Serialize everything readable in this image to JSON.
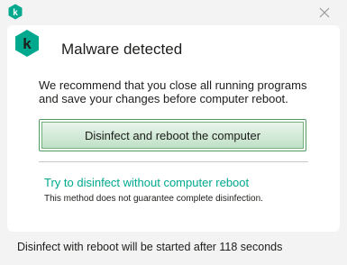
{
  "window": {
    "close_label": "Close"
  },
  "dialog": {
    "heading": "Malware detected",
    "message": "We recommend that you close all running programs and save your changes before computer reboot.",
    "primary_button_label": "Disinfect and reboot the computer",
    "alt_link_label": "Try to disinfect without computer reboot",
    "alt_note": "This method does not guarantee complete disinfection."
  },
  "footer": {
    "status_text": "Disinfect with reboot will be started after 118 seconds"
  },
  "icons": {
    "title_logo": "kaspersky-logo-icon",
    "card_logo": "kaspersky-logo-icon",
    "close": "close-icon"
  },
  "colors": {
    "brand_green": "#00a88e",
    "button_border": "#4e9a62",
    "button_fill_top": "#e9f5eb",
    "button_fill_bottom": "#bfe0c6",
    "background": "#f3f3f3",
    "card": "#ffffff"
  }
}
